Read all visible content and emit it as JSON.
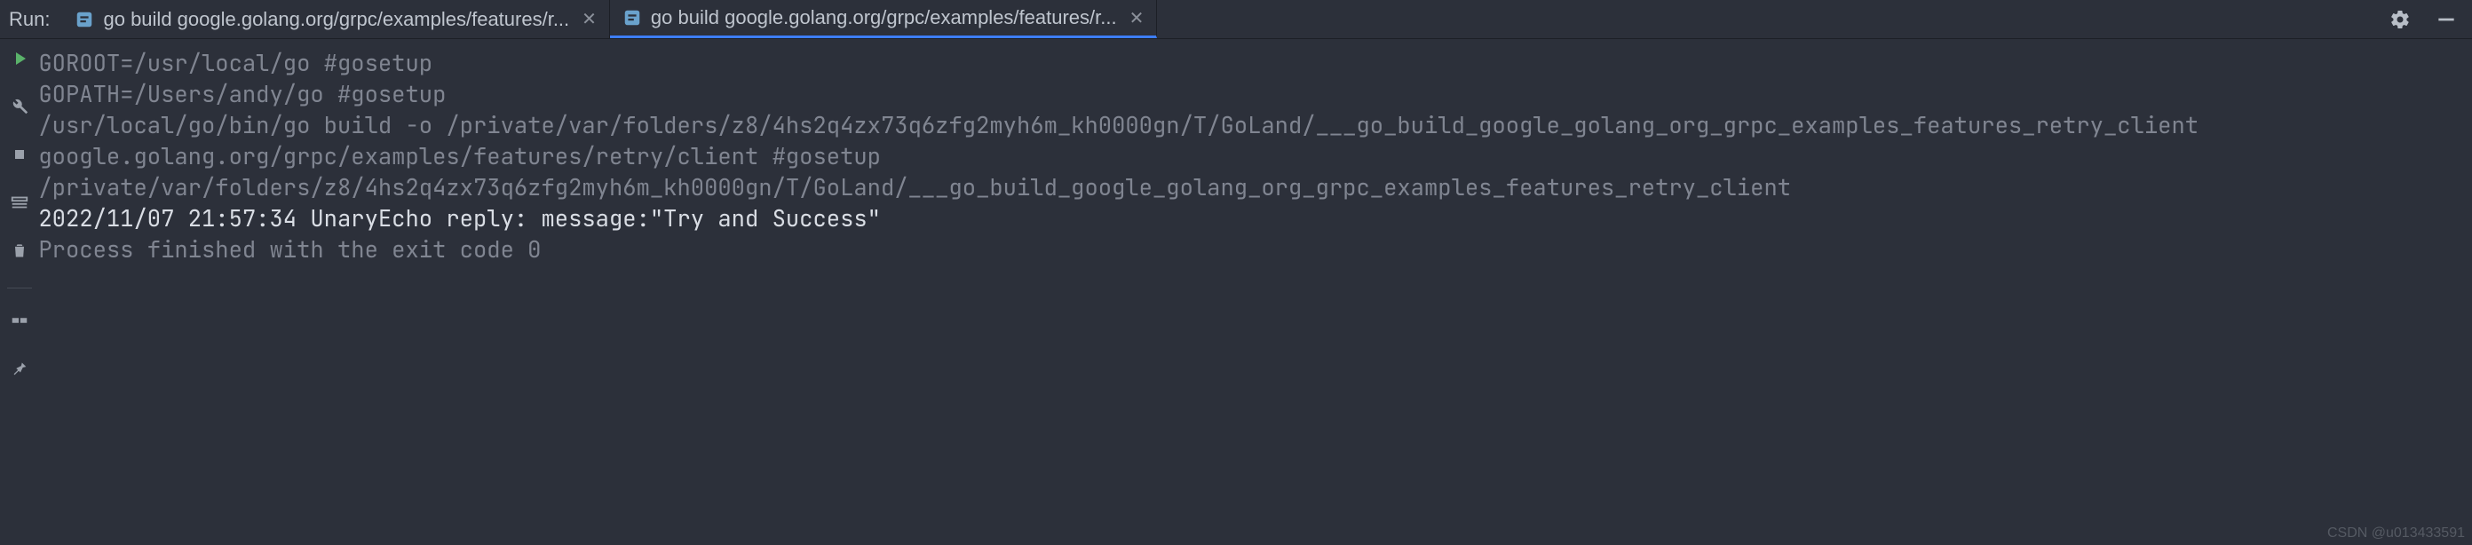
{
  "topbar": {
    "run_label": "Run:",
    "tabs": [
      {
        "label": "go build google.golang.org/grpc/examples/features/r...",
        "active": false
      },
      {
        "label": "go build google.golang.org/grpc/examples/features/r...",
        "active": true
      }
    ]
  },
  "gutter": {
    "buttons": [
      {
        "name": "run-button",
        "icon": "play"
      },
      {
        "name": "debug-button",
        "icon": "wrench"
      },
      {
        "name": "stop-button",
        "icon": "stop"
      },
      {
        "name": "layout-button",
        "icon": "layout"
      },
      {
        "name": "trash-button",
        "icon": "trash"
      },
      {
        "name": "sep",
        "icon": ""
      },
      {
        "name": "split-button",
        "icon": "split"
      },
      {
        "name": "pin-button",
        "icon": "pin"
      }
    ]
  },
  "toolbar_icons": {
    "settings": "gear-icon",
    "hide": "minimize-icon"
  },
  "console": {
    "lines": [
      {
        "style": "dim",
        "text": "GOROOT=/usr/local/go #gosetup"
      },
      {
        "style": "dim",
        "text": "GOPATH=/Users/andy/go #gosetup"
      },
      {
        "style": "dim",
        "text": "/usr/local/go/bin/go build -o /private/var/folders/z8/4hs2q4zx73q6zfg2myh6m_kh0000gn/T/GoLand/___go_build_google_golang_org_grpc_examples_features_retry_client google.golang.org/grpc/examples/features/retry/client #gosetup"
      },
      {
        "style": "dim",
        "text": "/private/var/folders/z8/4hs2q4zx73q6zfg2myh6m_kh0000gn/T/GoLand/___go_build_google_golang_org_grpc_examples_features_retry_client"
      },
      {
        "style": "bright",
        "text": "2022/11/07 21:57:34 UnaryEcho reply: message:\"Try and Success\""
      },
      {
        "style": "dim",
        "text": ""
      },
      {
        "style": "dim",
        "text": "Process finished with the exit code 0"
      }
    ]
  },
  "watermark": "CSDN @u013433591"
}
